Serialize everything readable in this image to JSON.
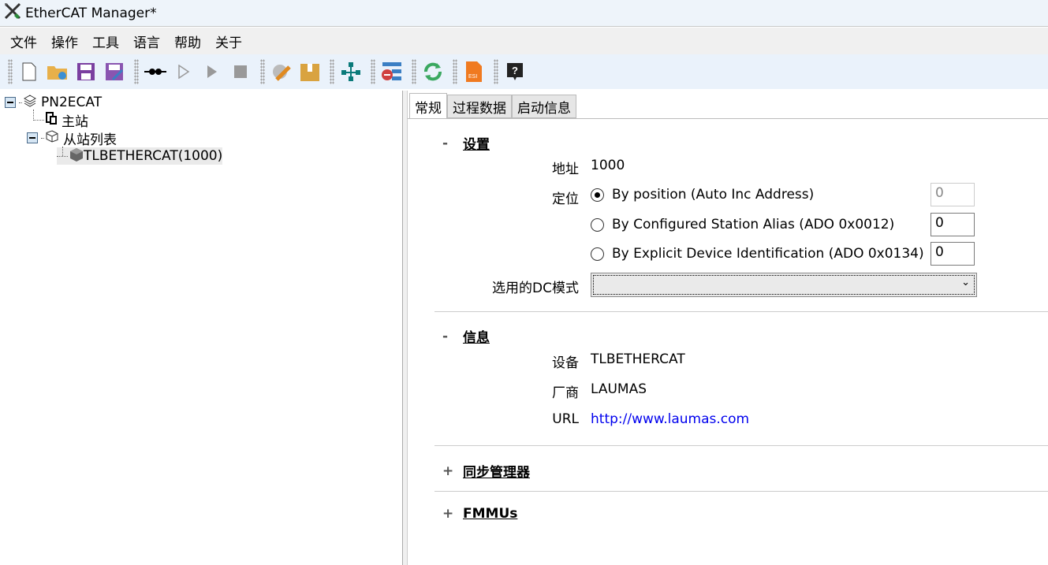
{
  "window": {
    "title": "EtherCAT Manager*"
  },
  "menu": [
    "文件",
    "操作",
    "工具",
    "语言",
    "帮助",
    "关于"
  ],
  "tree": {
    "root": "PN2ECAT",
    "master": "主站",
    "slaves": "从站列表",
    "slave1": "TLBETHERCAT(1000)"
  },
  "tabs": [
    "常规",
    "过程数据",
    "启动信息"
  ],
  "settings": {
    "header": "设置",
    "collapse": "-",
    "address_label": "地址",
    "address": "1000",
    "position_label": "定位",
    "options": [
      "By position (Auto Inc Address)",
      "By Configured Station Alias (ADO 0x0012)",
      "By Explicit Device Identification (ADO 0x0134)"
    ],
    "selected_option": 0,
    "values": [
      "0",
      "0",
      "0"
    ],
    "dc_label": "选用的DC模式",
    "dc_value": ""
  },
  "info": {
    "header": "信息",
    "collapse": "-",
    "device_label": "设备",
    "device": "TLBETHERCAT",
    "vendor_label": "厂商",
    "vendor": "LAUMAS",
    "url_label": "URL",
    "url": "http://www.laumas.com"
  },
  "sync": {
    "header": "同步管理器",
    "expand": "+"
  },
  "fmmu": {
    "header": "FMMUs",
    "expand": "+"
  }
}
